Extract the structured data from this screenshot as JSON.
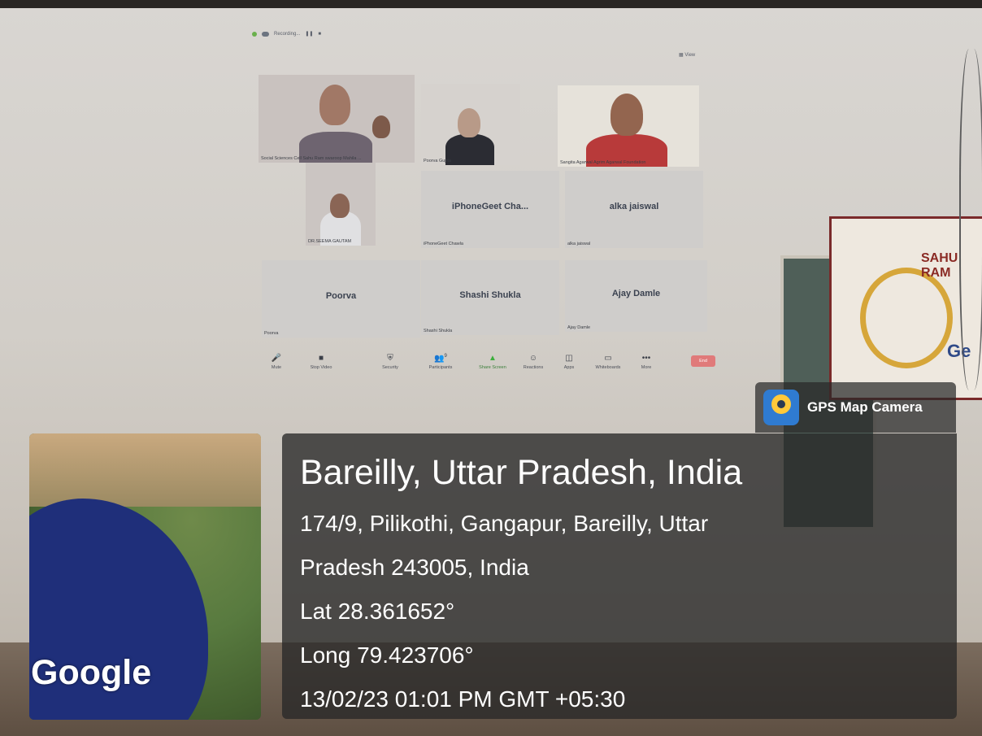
{
  "zoom": {
    "recording_label": "Recording...",
    "view_label": "View",
    "tiles": [
      {
        "caption": "Social Sciences Cell Sahu Ram swaroop Mahila ...",
        "kind": "video"
      },
      {
        "caption": "Poorva Gupta",
        "kind": "video"
      },
      {
        "caption": "Sangita Agarwal Agrim Agarwal Foundation",
        "kind": "video"
      },
      {
        "caption": "DR.SEEMA GAUTAM",
        "kind": "video"
      },
      {
        "caption": "iPhoneGeet Chawla",
        "name": "iPhoneGeet  Cha...",
        "kind": "name"
      },
      {
        "caption": "alka jaiswal",
        "name": "alka jaiswal",
        "kind": "name"
      },
      {
        "caption": "Poorva",
        "name": "Poorva",
        "kind": "name"
      },
      {
        "caption": "Shashi Shukla",
        "name": "Shashi Shukla",
        "kind": "name"
      },
      {
        "caption": "Ajay Damle",
        "name": "Ajay Damle",
        "kind": "name"
      }
    ],
    "toolbar": {
      "mute": "Mute",
      "stop_video": "Stop Video",
      "security": "Security",
      "participants": "Participants",
      "participants_count": "9",
      "share_screen": "Share Screen",
      "reactions": "Reactions",
      "apps": "Apps",
      "whiteboards": "Whiteboards",
      "more": "More",
      "end": "End"
    }
  },
  "banner": {
    "title": "SAHU RAM",
    "text": "Ge"
  },
  "gps": {
    "app_name": "GPS Map Camera",
    "place": "Bareilly, Uttar Pradesh, India",
    "address_line1": "174/9, Pilikothi, Gangapur, Bareilly, Uttar",
    "address_line2": "Pradesh 243005, India",
    "lat": "Lat 28.361652°",
    "long": "Long 79.423706°",
    "datetime": "13/02/23 01:01 PM GMT +05:30",
    "map_brand": "Google"
  }
}
